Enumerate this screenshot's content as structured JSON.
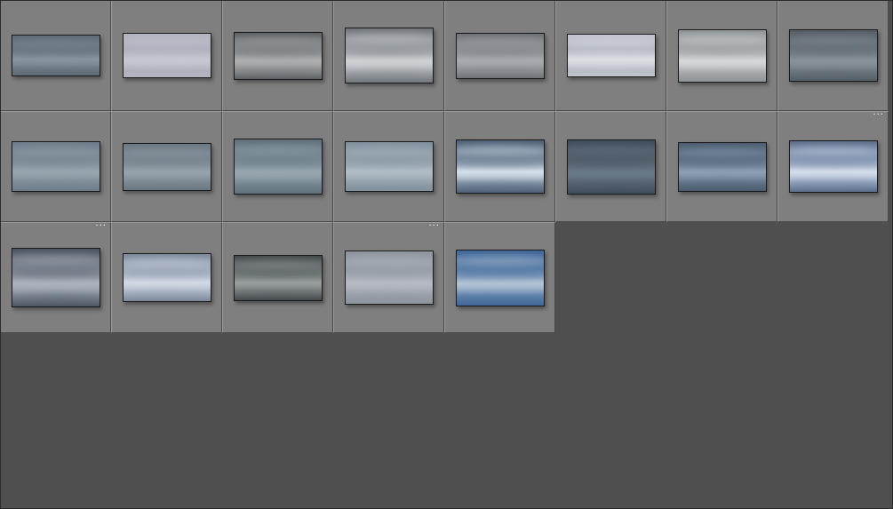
{
  "grid": {
    "cells": [
      {
        "name": "cloud-thumbnail-01",
        "w": 100,
        "h": 47,
        "sky": [
          "#5e6a76",
          "#8a96a2",
          "#6c7884"
        ],
        "has_badge": false
      },
      {
        "name": "cloud-thumbnail-02",
        "w": 100,
        "h": 51,
        "sky": [
          "#b3b6c1",
          "#c8cad3",
          "#aeb1bd"
        ],
        "has_badge": false
      },
      {
        "name": "cloud-thumbnail-03",
        "w": 100,
        "h": 54,
        "sky": [
          "#5c6066",
          "#aeb0b1",
          "#8b8e90"
        ],
        "has_badge": false
      },
      {
        "name": "cloud-thumbnail-04",
        "w": 100,
        "h": 63,
        "sky": [
          "#6f7479",
          "#d0d3d6",
          "#9fa4a9"
        ],
        "has_badge": false
      },
      {
        "name": "cloud-thumbnail-05",
        "w": 100,
        "h": 52,
        "sky": [
          "#6e7277",
          "#a9acb0",
          "#8f9398"
        ],
        "has_badge": false
      },
      {
        "name": "cloud-thumbnail-06",
        "w": 100,
        "h": 49,
        "sky": [
          "#c0c4cc",
          "#dee0e5",
          "#b6bac3"
        ],
        "has_badge": false
      },
      {
        "name": "cloud-thumbnail-07",
        "w": 100,
        "h": 60,
        "sky": [
          "#8d9295",
          "#d7d9da",
          "#a7abad"
        ],
        "has_badge": false
      },
      {
        "name": "cloud-thumbnail-08",
        "w": 100,
        "h": 59,
        "sky": [
          "#545d65",
          "#8b949c",
          "#6d767e"
        ],
        "has_badge": false
      },
      {
        "name": "cloud-thumbnail-09",
        "w": 100,
        "h": 57,
        "sky": [
          "#6c7c88",
          "#9aa7b1",
          "#7f8d98"
        ],
        "has_badge": false
      },
      {
        "name": "cloud-thumbnail-10",
        "w": 100,
        "h": 54,
        "sky": [
          "#6a7782",
          "#98a4ad",
          "#7d8a94"
        ],
        "has_badge": false
      },
      {
        "name": "cloud-thumbnail-11",
        "w": 100,
        "h": 63,
        "sky": [
          "#5f6f79",
          "#98a7b0",
          "#7a8a94"
        ],
        "has_badge": false
      },
      {
        "name": "cloud-thumbnail-12",
        "w": 100,
        "h": 57,
        "sky": [
          "#7f8f9b",
          "#b2bec8",
          "#93a1ac"
        ],
        "has_badge": false
      },
      {
        "name": "cloud-thumbnail-13",
        "w": 100,
        "h": 61,
        "sky": [
          "#4d5e74",
          "#d6e1ec",
          "#7d8fa3"
        ],
        "has_badge": false
      },
      {
        "name": "cloud-thumbnail-14",
        "w": 100,
        "h": 62,
        "sky": [
          "#3f4b58",
          "#6b7a88",
          "#56636f"
        ],
        "has_badge": false
      },
      {
        "name": "cloud-thumbnail-15",
        "w": 100,
        "h": 56,
        "sky": [
          "#4a5b70",
          "#8ea1b6",
          "#637589"
        ],
        "has_badge": false
      },
      {
        "name": "cloud-thumbnail-16",
        "w": 100,
        "h": 59,
        "sky": [
          "#5c6d88",
          "#d5dfee",
          "#8d9fbb"
        ],
        "has_badge": true
      },
      {
        "name": "cloud-thumbnail-17",
        "w": 100,
        "h": 67,
        "sky": [
          "#4b5461",
          "#aeb5bf",
          "#7e8793"
        ],
        "has_badge": true
      },
      {
        "name": "cloud-thumbnail-18",
        "w": 100,
        "h": 55,
        "sky": [
          "#7b8799",
          "#d5dbe6",
          "#a6b1c2"
        ],
        "has_badge": false
      },
      {
        "name": "cloud-thumbnail-19",
        "w": 100,
        "h": 52,
        "sky": [
          "#42474c",
          "#9aa19f",
          "#6f7777"
        ],
        "has_badge": false
      },
      {
        "name": "cloud-thumbnail-20",
        "w": 100,
        "h": 61,
        "sky": [
          "#8d949d",
          "#b7bcc3",
          "#9aa1aa"
        ],
        "has_badge": true
      },
      {
        "name": "cloud-thumbnail-21",
        "w": 100,
        "h": 64,
        "sky": [
          "#3e6596",
          "#b5c4d6",
          "#5f82ab"
        ],
        "has_badge": false
      }
    ]
  },
  "badge_glyph": "···",
  "colors": {
    "cell_bg": "#7f7f7f",
    "empty_bg": "#4f4f4f"
  }
}
